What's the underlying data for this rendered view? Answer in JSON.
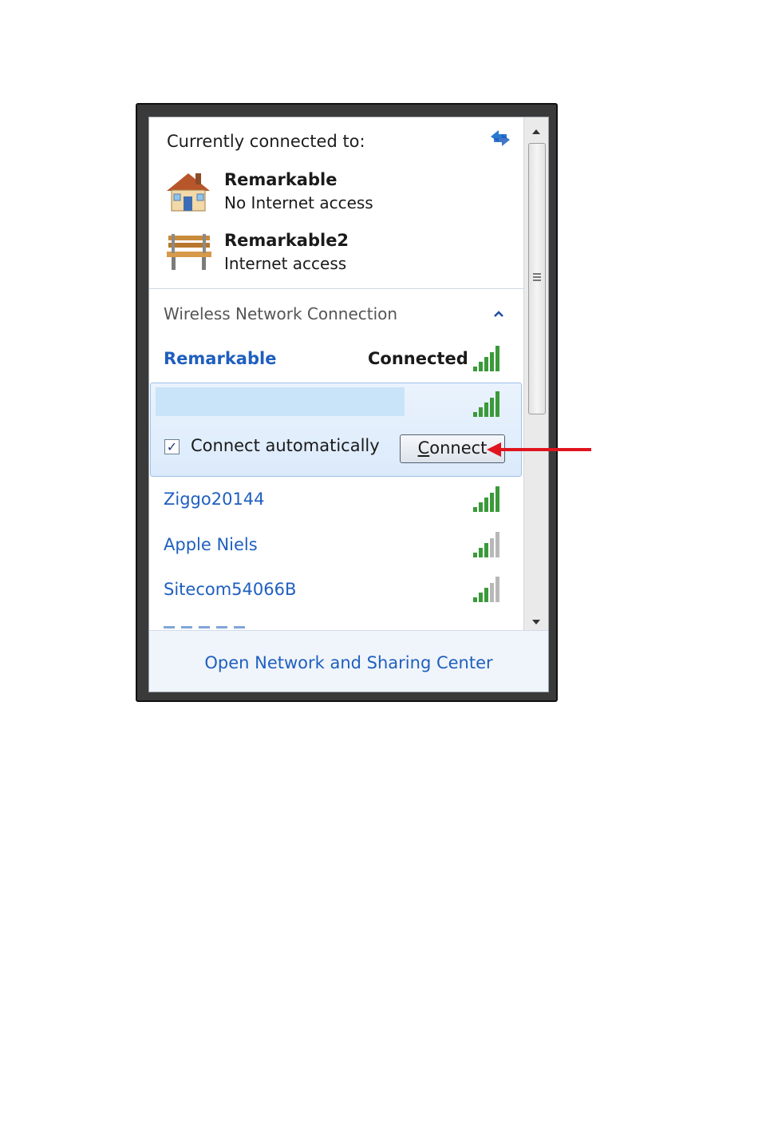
{
  "header": {
    "title": "Currently connected to:"
  },
  "connected_networks": [
    {
      "name": "Remarkable",
      "status": "No Internet access",
      "icon": "home-network-icon"
    },
    {
      "name": "Remarkable2",
      "status": "Internet access",
      "icon": "public-network-bench-icon"
    }
  ],
  "wireless": {
    "section_label": "Wireless Network Connection",
    "connected": {
      "name": "Remarkable",
      "status": "Connected"
    },
    "selected": {
      "name": "",
      "checkbox_label": "Connect automatically",
      "checkbox_checked": true,
      "connect_button": "Connect",
      "connect_button_mnemonic": "C",
      "connect_button_rest": "onnect"
    },
    "networks": [
      {
        "name": "Ziggo20144",
        "signal": 5
      },
      {
        "name": "Apple Niels",
        "signal": 3
      },
      {
        "name": "Sitecom54066B",
        "signal": 3
      }
    ]
  },
  "footer": {
    "link": "Open Network and Sharing Center"
  },
  "colors": {
    "link_blue": "#1f5fbf",
    "signal_green": "#3a9a3a",
    "signal_gray": "#b8b8b8",
    "annotation_arrow": "#e0141e"
  }
}
